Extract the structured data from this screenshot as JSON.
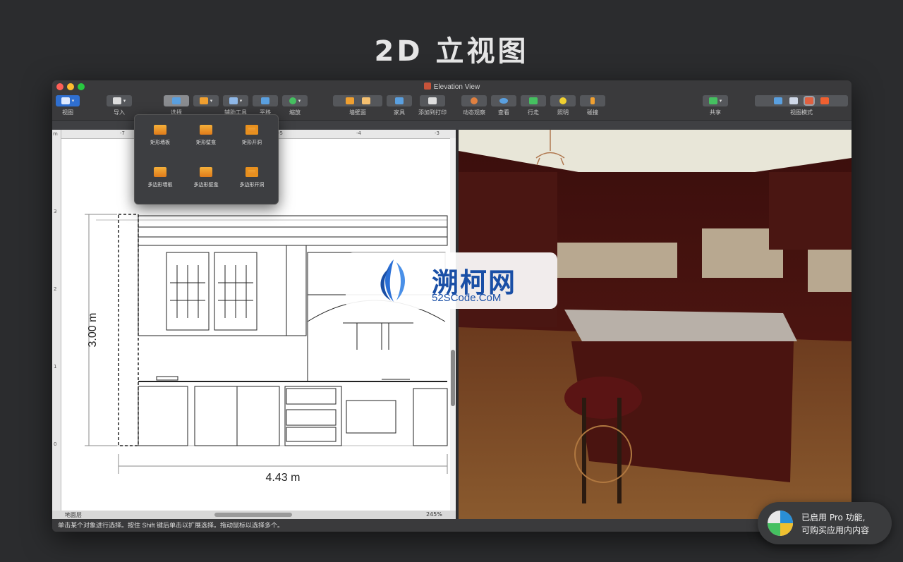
{
  "hero_title": "2D 立视图",
  "window": {
    "title": "Elevation View",
    "traffic_colors": [
      "#fe5f57",
      "#febc2e",
      "#28c840"
    ]
  },
  "toolbar": {
    "items": [
      {
        "label": "视图",
        "icon": "view-icon",
        "color": "#5aa0e0"
      },
      {
        "label": "导入",
        "icon": "import-icon",
        "color": "#dddddd"
      },
      {
        "label": "选择",
        "icon": "select-icon",
        "color": "#5aa0e0"
      },
      {
        "label": "",
        "icon": "wall-icon",
        "color": "#f0a030"
      },
      {
        "label": "辅助工具",
        "icon": "helper-tools-icon",
        "color": "#8fb8e8"
      },
      {
        "label": "平移",
        "icon": "pan-hand-icon",
        "color": "#5aa0e0"
      },
      {
        "label": "缩放",
        "icon": "zoom-icon",
        "color": "#45c060"
      },
      {
        "label": "墙壁面",
        "icon": "wall-face-icon",
        "color": "#f0a030"
      },
      {
        "label": "家具",
        "icon": "furniture-icon",
        "color": "#5aa0e0"
      },
      {
        "label": "添加到打印",
        "icon": "print-icon",
        "color": "#dddddd"
      },
      {
        "label": "动态观察",
        "icon": "orbit-icon",
        "color": "#e08040"
      },
      {
        "label": "查看",
        "icon": "eye-icon",
        "color": "#5aa0e0"
      },
      {
        "label": "行走",
        "icon": "walk-icon",
        "color": "#45c060"
      },
      {
        "label": "照明",
        "icon": "light-bulb-icon",
        "color": "#f0d030"
      },
      {
        "label": "碰撞",
        "icon": "collision-icon",
        "color": "#f0a030"
      },
      {
        "label": "共享",
        "icon": "share-icon",
        "color": "#45c060"
      },
      {
        "label": "视图模式",
        "icon": "view-mode-icon",
        "color": "#5aa0e0"
      }
    ]
  },
  "popover": {
    "items": [
      {
        "label": "矩形墙板"
      },
      {
        "label": "矩形壁龛"
      },
      {
        "label": "矩形开洞"
      },
      {
        "label": "多边形墙板"
      },
      {
        "label": "多边形壁龛"
      },
      {
        "label": "多边形开洞"
      }
    ]
  },
  "rulers": {
    "top_ticks": [
      "-7",
      "-6",
      "-5",
      "-4",
      "-3"
    ],
    "left_ticks": [
      "3",
      "2",
      "1",
      "0"
    ],
    "unit": "m"
  },
  "drawing": {
    "height_dimension": "3.00 m",
    "width_dimension": "4.43 m"
  },
  "bottom_bar": {
    "layer": "地面层",
    "zoom": "245%"
  },
  "status": {
    "text": "单击某个对象进行选择。按住 Shift 键后单击以扩展选择。拖动鼠标以选择多个。"
  },
  "watermark": {
    "name": "溯柯网",
    "url": "52SCode.CoM"
  },
  "pro_badge": {
    "line1": "已启用 Pro 功能,",
    "line2": "可购买应用内内容"
  }
}
